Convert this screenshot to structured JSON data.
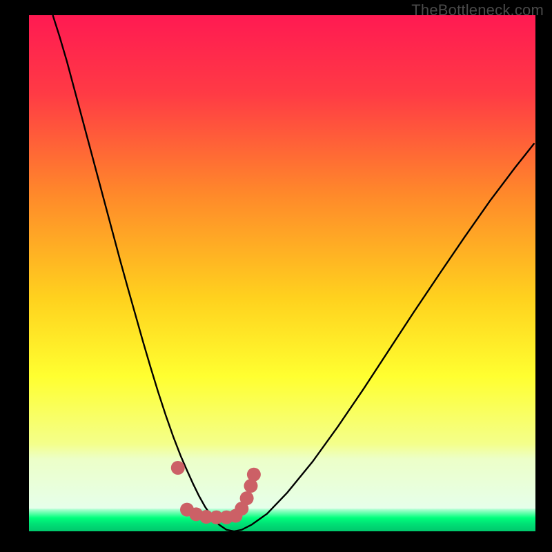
{
  "watermark": "TheBottleneck.com",
  "chart_data": {
    "type": "line",
    "title": "",
    "xlabel": "",
    "ylabel": "",
    "xlim": [
      0,
      1
    ],
    "ylim": [
      0,
      1
    ],
    "gradient_stops": [
      {
        "offset": 0.0,
        "color": "#ff1a52"
      },
      {
        "offset": 0.15,
        "color": "#ff3a45"
      },
      {
        "offset": 0.35,
        "color": "#ff8a2a"
      },
      {
        "offset": 0.55,
        "color": "#ffd21e"
      },
      {
        "offset": 0.7,
        "color": "#ffff30"
      },
      {
        "offset": 0.83,
        "color": "#f4ff8a"
      },
      {
        "offset": 0.86,
        "color": "#ecffc8"
      },
      {
        "offset": 0.955,
        "color": "#e6ffea"
      },
      {
        "offset": 0.958,
        "color": "#a9ffcf"
      },
      {
        "offset": 0.974,
        "color": "#00ff7c"
      },
      {
        "offset": 0.985,
        "color": "#00e176"
      },
      {
        "offset": 1.0,
        "color": "#00c86c"
      }
    ],
    "series": [
      {
        "name": "bottleneck-curve",
        "color": "#000000",
        "width": 2.4,
        "x": [
          0.047,
          0.06,
          0.075,
          0.09,
          0.105,
          0.12,
          0.135,
          0.15,
          0.165,
          0.18,
          0.195,
          0.21,
          0.225,
          0.24,
          0.255,
          0.27,
          0.285,
          0.3,
          0.312,
          0.324,
          0.336,
          0.348,
          0.36,
          0.375,
          0.39,
          0.405,
          0.42,
          0.44,
          0.47,
          0.51,
          0.56,
          0.61,
          0.66,
          0.71,
          0.76,
          0.81,
          0.86,
          0.91,
          0.96,
          0.998
        ],
        "y": [
          1.0,
          0.96,
          0.91,
          0.855,
          0.8,
          0.745,
          0.69,
          0.635,
          0.58,
          0.525,
          0.472,
          0.42,
          0.368,
          0.318,
          0.27,
          0.225,
          0.183,
          0.145,
          0.118,
          0.092,
          0.068,
          0.047,
          0.03,
          0.013,
          0.003,
          0.0,
          0.003,
          0.013,
          0.034,
          0.075,
          0.135,
          0.203,
          0.275,
          0.35,
          0.425,
          0.498,
          0.57,
          0.64,
          0.705,
          0.752
        ]
      }
    ],
    "markers": {
      "name": "sweet-spot-markers",
      "color": "#cc6066",
      "radius": 10,
      "points": [
        {
          "x": 0.294,
          "y": 0.123
        },
        {
          "x": 0.312,
          "y": 0.042
        },
        {
          "x": 0.33,
          "y": 0.033
        },
        {
          "x": 0.35,
          "y": 0.028
        },
        {
          "x": 0.37,
          "y": 0.027
        },
        {
          "x": 0.39,
          "y": 0.027
        },
        {
          "x": 0.408,
          "y": 0.03
        },
        {
          "x": 0.42,
          "y": 0.044
        },
        {
          "x": 0.43,
          "y": 0.064
        },
        {
          "x": 0.438,
          "y": 0.088
        },
        {
          "x": 0.444,
          "y": 0.11
        }
      ]
    }
  }
}
